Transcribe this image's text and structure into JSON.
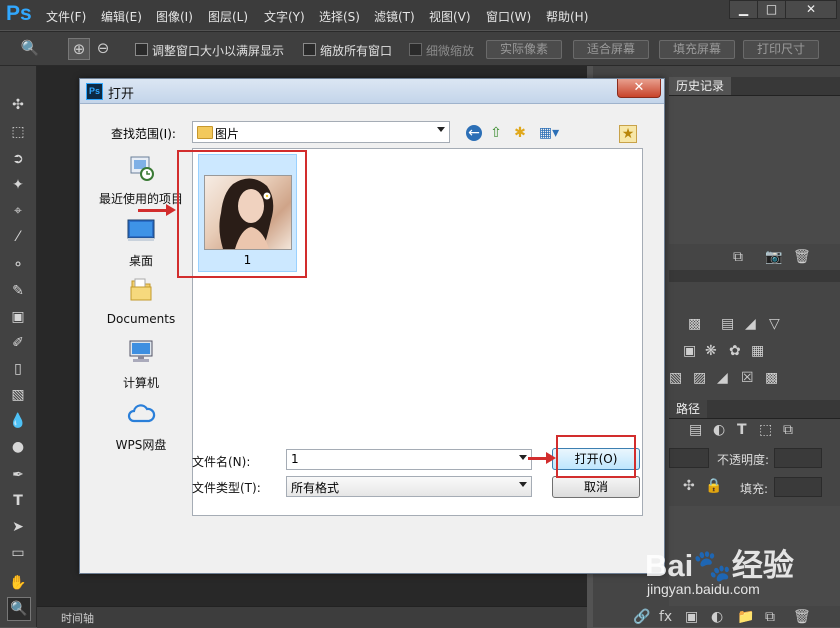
{
  "app": {
    "logo": "Ps",
    "menu": [
      "文件(F)",
      "编辑(E)",
      "图像(I)",
      "图层(L)",
      "文字(Y)",
      "选择(S)",
      "滤镜(T)",
      "视图(V)",
      "窗口(W)",
      "帮助(H)"
    ],
    "window_controls": [
      "▁",
      "□",
      "✕"
    ]
  },
  "options_bar": {
    "check_resize": "调整窗口大小以满屏显示",
    "check_zoom_all": "缩放所有窗口",
    "check_scrubby": "细微缩放",
    "btn_actual": "实际像素",
    "btn_fit": "适合屏幕",
    "btn_fill": "填充屏幕",
    "btn_print": "打印尺寸"
  },
  "panels": {
    "history_tab": "历史记录",
    "paths_tab": "路径",
    "opacity_label": "不透明度:",
    "fill_label": "填充:"
  },
  "timeline": {
    "label": "时间轴"
  },
  "dialog": {
    "title": "打开",
    "lookin_label": "查找范围(I):",
    "lookin_value": "图片",
    "places": [
      {
        "label": "最近使用的项目",
        "icon": "recent-items-icon"
      },
      {
        "label": "桌面",
        "icon": "desktop-icon"
      },
      {
        "label": "Documents",
        "icon": "documents-folder-icon"
      },
      {
        "label": "计算机",
        "icon": "computer-icon"
      },
      {
        "label": "WPS网盘",
        "icon": "wps-cloud-icon"
      }
    ],
    "file": {
      "name": "1"
    },
    "filename_label": "文件名(N):",
    "filename_value": "1",
    "filetype_label": "文件类型(T):",
    "filetype_value": "所有格式",
    "open_button": "打开(O)",
    "cancel_button": "取消"
  },
  "watermark": {
    "main": "Bai🐾经验",
    "sub": "jingyan.baidu.com"
  },
  "colors": {
    "highlight": "#d22d2d",
    "selection": "#cce8ff"
  }
}
